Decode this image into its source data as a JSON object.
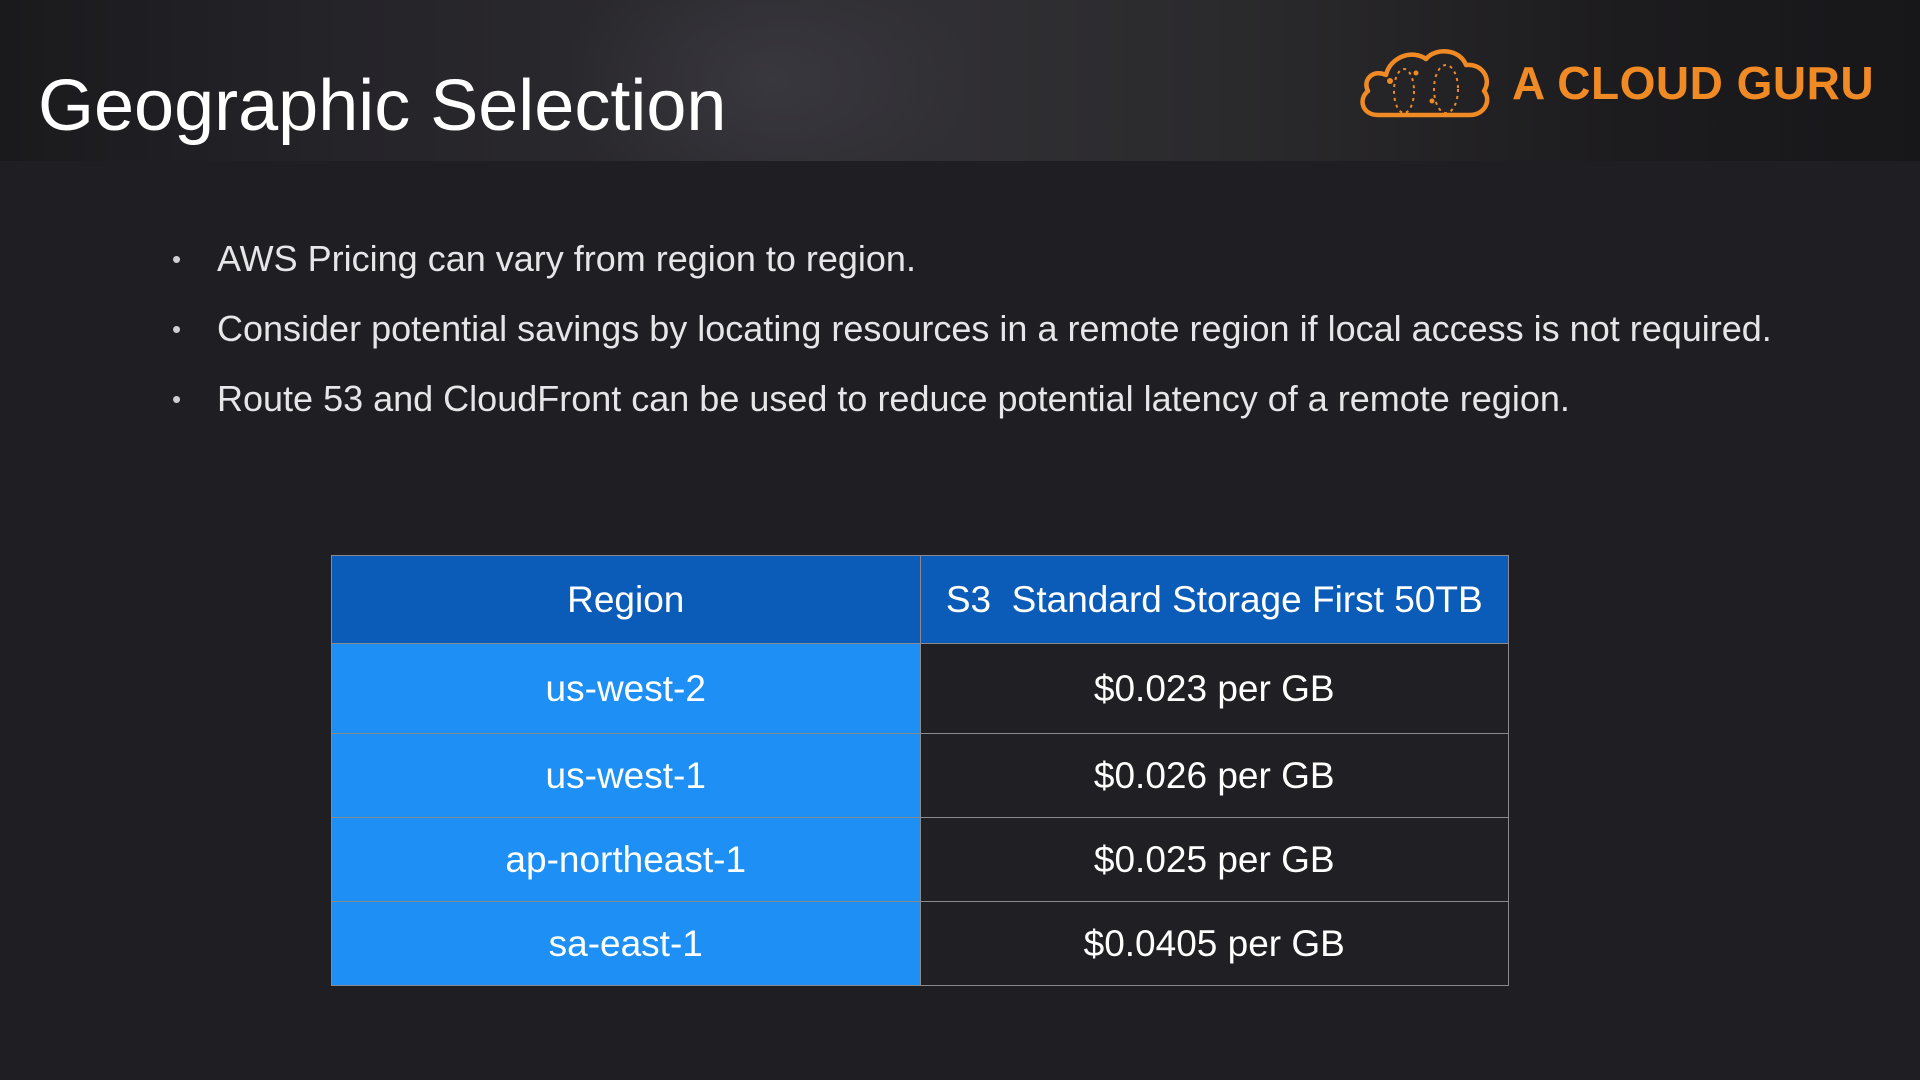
{
  "slide": {
    "title": "Geographic Selection",
    "logo": {
      "text": "A CLOUD GURU",
      "icon": "cloud-logo-icon",
      "color": "#f08a24"
    },
    "bullets": [
      "AWS Pricing can vary from region to region.",
      "Consider potential savings by locating resources in a remote region if local access is not required.",
      "Route 53 and CloudFront can be used to reduce potential latency of a remote region."
    ],
    "table": {
      "headers": [
        "Region",
        "S3  Standard Storage First 50TB"
      ],
      "rows": [
        [
          "us-west-2",
          "$0.023 per GB"
        ],
        [
          "us-west-1",
          "$0.026 per GB"
        ],
        [
          "ap-northeast-1",
          "$0.025 per GB"
        ],
        [
          "sa-east-1",
          "$0.0405 per GB"
        ]
      ]
    },
    "colors": {
      "header_cell": "#0b5cb8",
      "region_cell": "#1e90f5",
      "background": "#1f1e22"
    }
  }
}
